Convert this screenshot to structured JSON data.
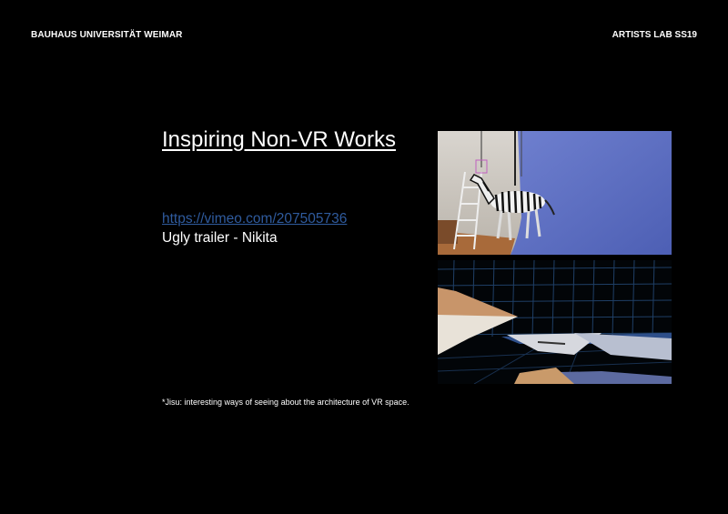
{
  "header": {
    "left": "BAUHAUS UNIVERSITÄT WEIMAR",
    "right": "ARTISTS LAB SS19"
  },
  "slide": {
    "title": "Inspiring Non-VR Works",
    "link": "https://vimeo.com/207505736",
    "caption": "Ugly trailer - Nikita",
    "note": "*Jisu: interesting ways of seeing about the architecture of VR space."
  },
  "images": {
    "top": {
      "subject": "zebra puppet on ladder in blue-screen studio"
    },
    "bottom": {
      "subject": "wireframe grid room with floating paper planes"
    }
  },
  "colors": {
    "background": "#000000",
    "text": "#ffffff",
    "link": "#2f5b9e",
    "bluescreen": "#5d6fc2"
  }
}
